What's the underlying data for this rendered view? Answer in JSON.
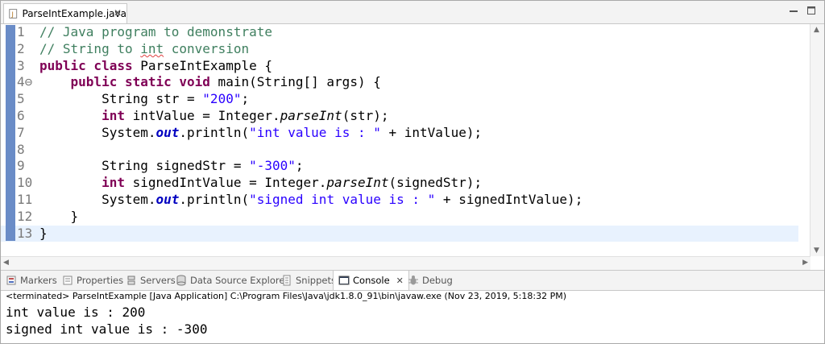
{
  "editor_tab": {
    "title": "ParseIntExample.java",
    "close": "✕"
  },
  "code": {
    "line_numbers": [
      "1",
      "2",
      "3",
      "4⊖",
      "5",
      "6",
      "7",
      "8",
      "9",
      "10",
      "11",
      "12",
      "13"
    ],
    "lines": {
      "l1": "// Java program to demonstrate",
      "l2a": "// String to ",
      "l2b": "int",
      "l2c": " conversion",
      "l3a": "public class",
      "l3b": " ParseIntExample {",
      "l4a": "    public static void",
      "l4b": " main(String[] args) {",
      "l5a": "        String str = ",
      "l5b": "\"200\"",
      "l5c": ";",
      "l6a": "        int",
      "l6b": " intValue = Integer.",
      "l6c": "parseInt",
      "l6d": "(str);",
      "l7a": "        System.",
      "l7b": "out",
      "l7c": ".println(",
      "l7d": "\"int value is : \"",
      "l7e": " + intValue);",
      "l8": "",
      "l9a": "        String signedStr = ",
      "l9b": "\"-300\"",
      "l9c": ";",
      "l10a": "        int",
      "l10b": " signedIntValue = Integer.",
      "l10c": "parseInt",
      "l10d": "(signedStr);",
      "l11a": "        System.",
      "l11b": "out",
      "l11c": ".println(",
      "l11d": "\"signed int value is : \"",
      "l11e": " + signedIntValue);",
      "l12": "    }",
      "l13": "}"
    }
  },
  "views": {
    "markers": "Markers",
    "properties": "Properties",
    "servers": "Servers",
    "data_source": "Data Source Explorer",
    "snippets": "Snippets",
    "console": "Console",
    "console_close": "✕",
    "debug": "Debug"
  },
  "console": {
    "status": "<terminated> ParseIntExample [Java Application] C:\\Program Files\\Java\\jdk1.8.0_91\\bin\\javaw.exe (Nov 23, 2019, 5:18:32 PM)",
    "output": [
      "int value is : 200",
      "signed int value is : -300"
    ]
  },
  "colors": {
    "keyword": "#7f0055",
    "comment": "#3f7f5f",
    "string": "#2a00ff",
    "field": "#0000c0"
  }
}
